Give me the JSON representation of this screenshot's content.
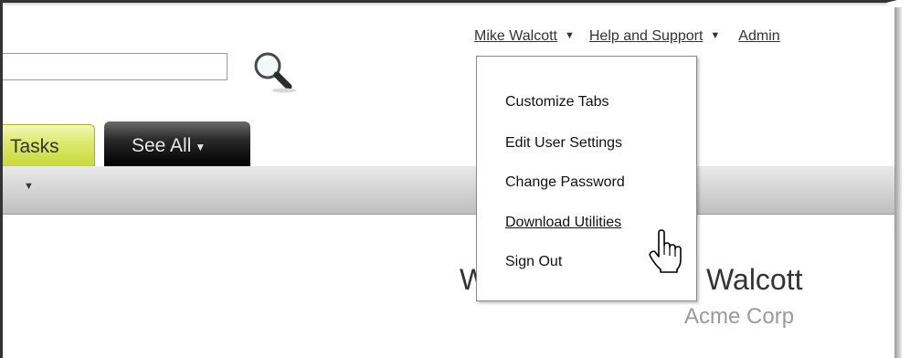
{
  "header": {
    "user_menu_label": "Mike Walcott",
    "help_label": "Help and Support",
    "admin_label": "Admin"
  },
  "search": {
    "value": "",
    "icon": "magnifier-icon"
  },
  "tabs": [
    {
      "label": "Tasks",
      "state": "active",
      "color": "#d4e04c"
    },
    {
      "label": "See All",
      "state": "default",
      "color": "#1a1a1a"
    }
  ],
  "user_menu": {
    "open": true,
    "items": [
      {
        "label": "Customize Tabs"
      },
      {
        "label": "Edit User Settings"
      },
      {
        "label": "Change Password"
      },
      {
        "label": "Download Utilities",
        "hovered": true
      },
      {
        "label": "Sign Out"
      }
    ]
  },
  "welcome": {
    "prefix_visible": "W",
    "name_visible": "Walcott",
    "company": "Acme Corp"
  },
  "cursor": "hand-pointer-icon"
}
